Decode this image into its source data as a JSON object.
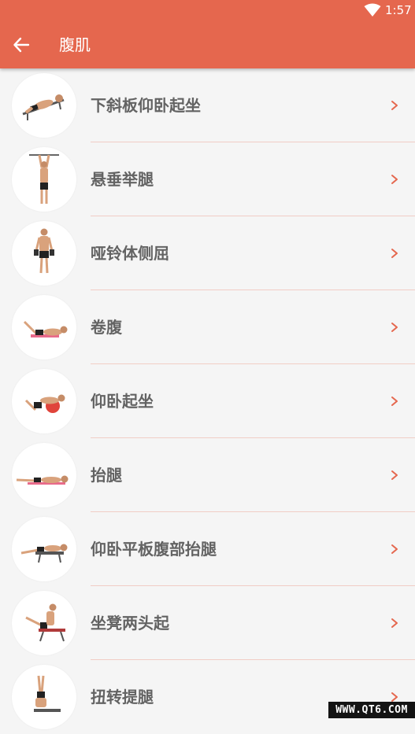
{
  "status_bar": {
    "time": "1:57",
    "wifi_icon": "wifi-icon"
  },
  "toolbar": {
    "title": "腹肌",
    "back_icon": "arrow-left-icon",
    "background_color": "#e5674e"
  },
  "exercises": [
    {
      "label": "下斜板仰卧起坐",
      "icon": "decline-situp-figure"
    },
    {
      "label": "悬垂举腿",
      "icon": "hanging-leg-raise-figure"
    },
    {
      "label": "哑铃体侧屈",
      "icon": "dumbbell-side-bend-figure"
    },
    {
      "label": "卷腹",
      "icon": "crunch-figure"
    },
    {
      "label": "仰卧起坐",
      "icon": "situp-figure"
    },
    {
      "label": "抬腿",
      "icon": "leg-raise-figure"
    },
    {
      "label": "仰卧平板腹部抬腿",
      "icon": "flat-bench-leg-raise-figure"
    },
    {
      "label": "坐凳两头起",
      "icon": "bench-v-up-figure"
    },
    {
      "label": "扭转提腿",
      "icon": "twisting-leg-raise-figure"
    }
  ],
  "chevron_icon": "chevron-right-icon",
  "accent_color": "#e5674e",
  "watermark": "WWW.QT6.COM"
}
